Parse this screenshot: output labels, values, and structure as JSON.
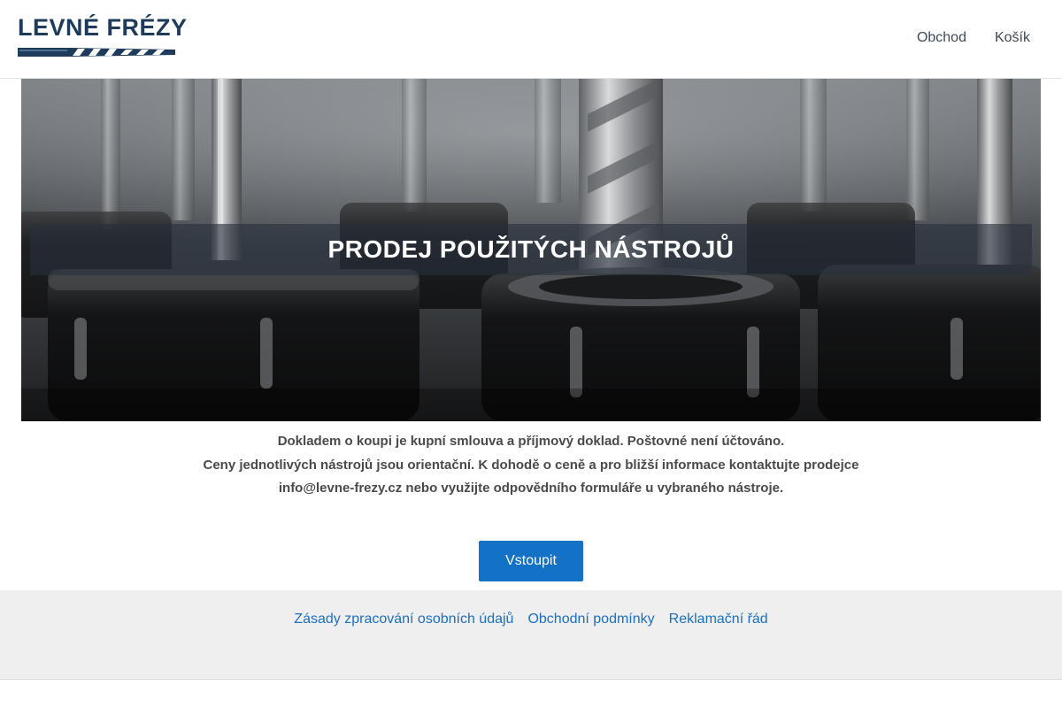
{
  "logo": {
    "text": "LEVNÉ FRÉZY",
    "icon": "drill-bit-icon"
  },
  "nav": {
    "items": [
      "Obchod",
      "Košík"
    ]
  },
  "hero": {
    "title": "PRODEJ POUŽITÝCH NÁSTROJŮ"
  },
  "info": {
    "line1": "Dokladem o koupi je kupní smlouva a příjmový doklad. Poštovné není účtováno.",
    "line2": "Ceny jednotlivých nástrojů jsou orientační. K dohodě o ceně a pro bližší informace kontaktujte prodejce",
    "line3": "info@levne-frezy.cz nebo využijte odpovědního formuláře u vybraného nástroje."
  },
  "enter_button": {
    "label": "Vstoupit"
  },
  "footer": {
    "links": [
      "Zásady zpracování osobních údajů",
      "Obchodní podmínky",
      "Reklamační řád"
    ]
  },
  "colors": {
    "brand": "#1f3b5c",
    "button": "#1371c6",
    "link": "#1d6fc0"
  }
}
